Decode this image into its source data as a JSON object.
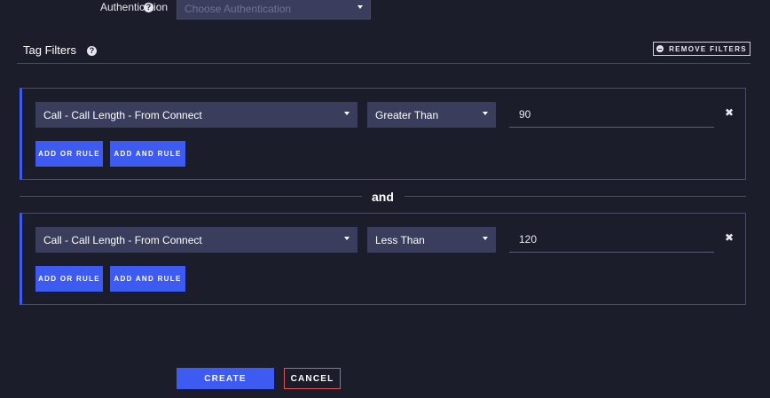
{
  "authentication": {
    "label": "Authentication",
    "help_icon": "question-circle-icon",
    "select_placeholder": "Choose Authentication",
    "caret_icon": "caret-down-icon"
  },
  "tag_filters": {
    "title": "Tag Filters",
    "help_icon": "question-circle-icon",
    "remove_filters_label": "REMOVE FILTERS",
    "remove_filters_icon": "minus-circle-icon"
  },
  "rule_groups": [
    {
      "field": "Call - Call Length - From Connect",
      "operator": "Greater Than",
      "value": "90",
      "remove_icon": "close-icon",
      "add_or_label": "ADD OR RULE",
      "add_and_label": "ADD AND RULE"
    },
    {
      "field": "Call - Call Length - From Connect",
      "operator": "Less Than",
      "value": "120",
      "remove_icon": "close-icon",
      "add_or_label": "ADD OR RULE",
      "add_and_label": "ADD AND RULE"
    }
  ],
  "group_separator": "and",
  "actions": {
    "create_label": "CREATE",
    "cancel_label": "CANCEL"
  },
  "colors": {
    "background": "#1c1d2b",
    "accent": "#3d5af1",
    "select_bg": "#3a3d5c",
    "cancel_border": "#e05555"
  }
}
